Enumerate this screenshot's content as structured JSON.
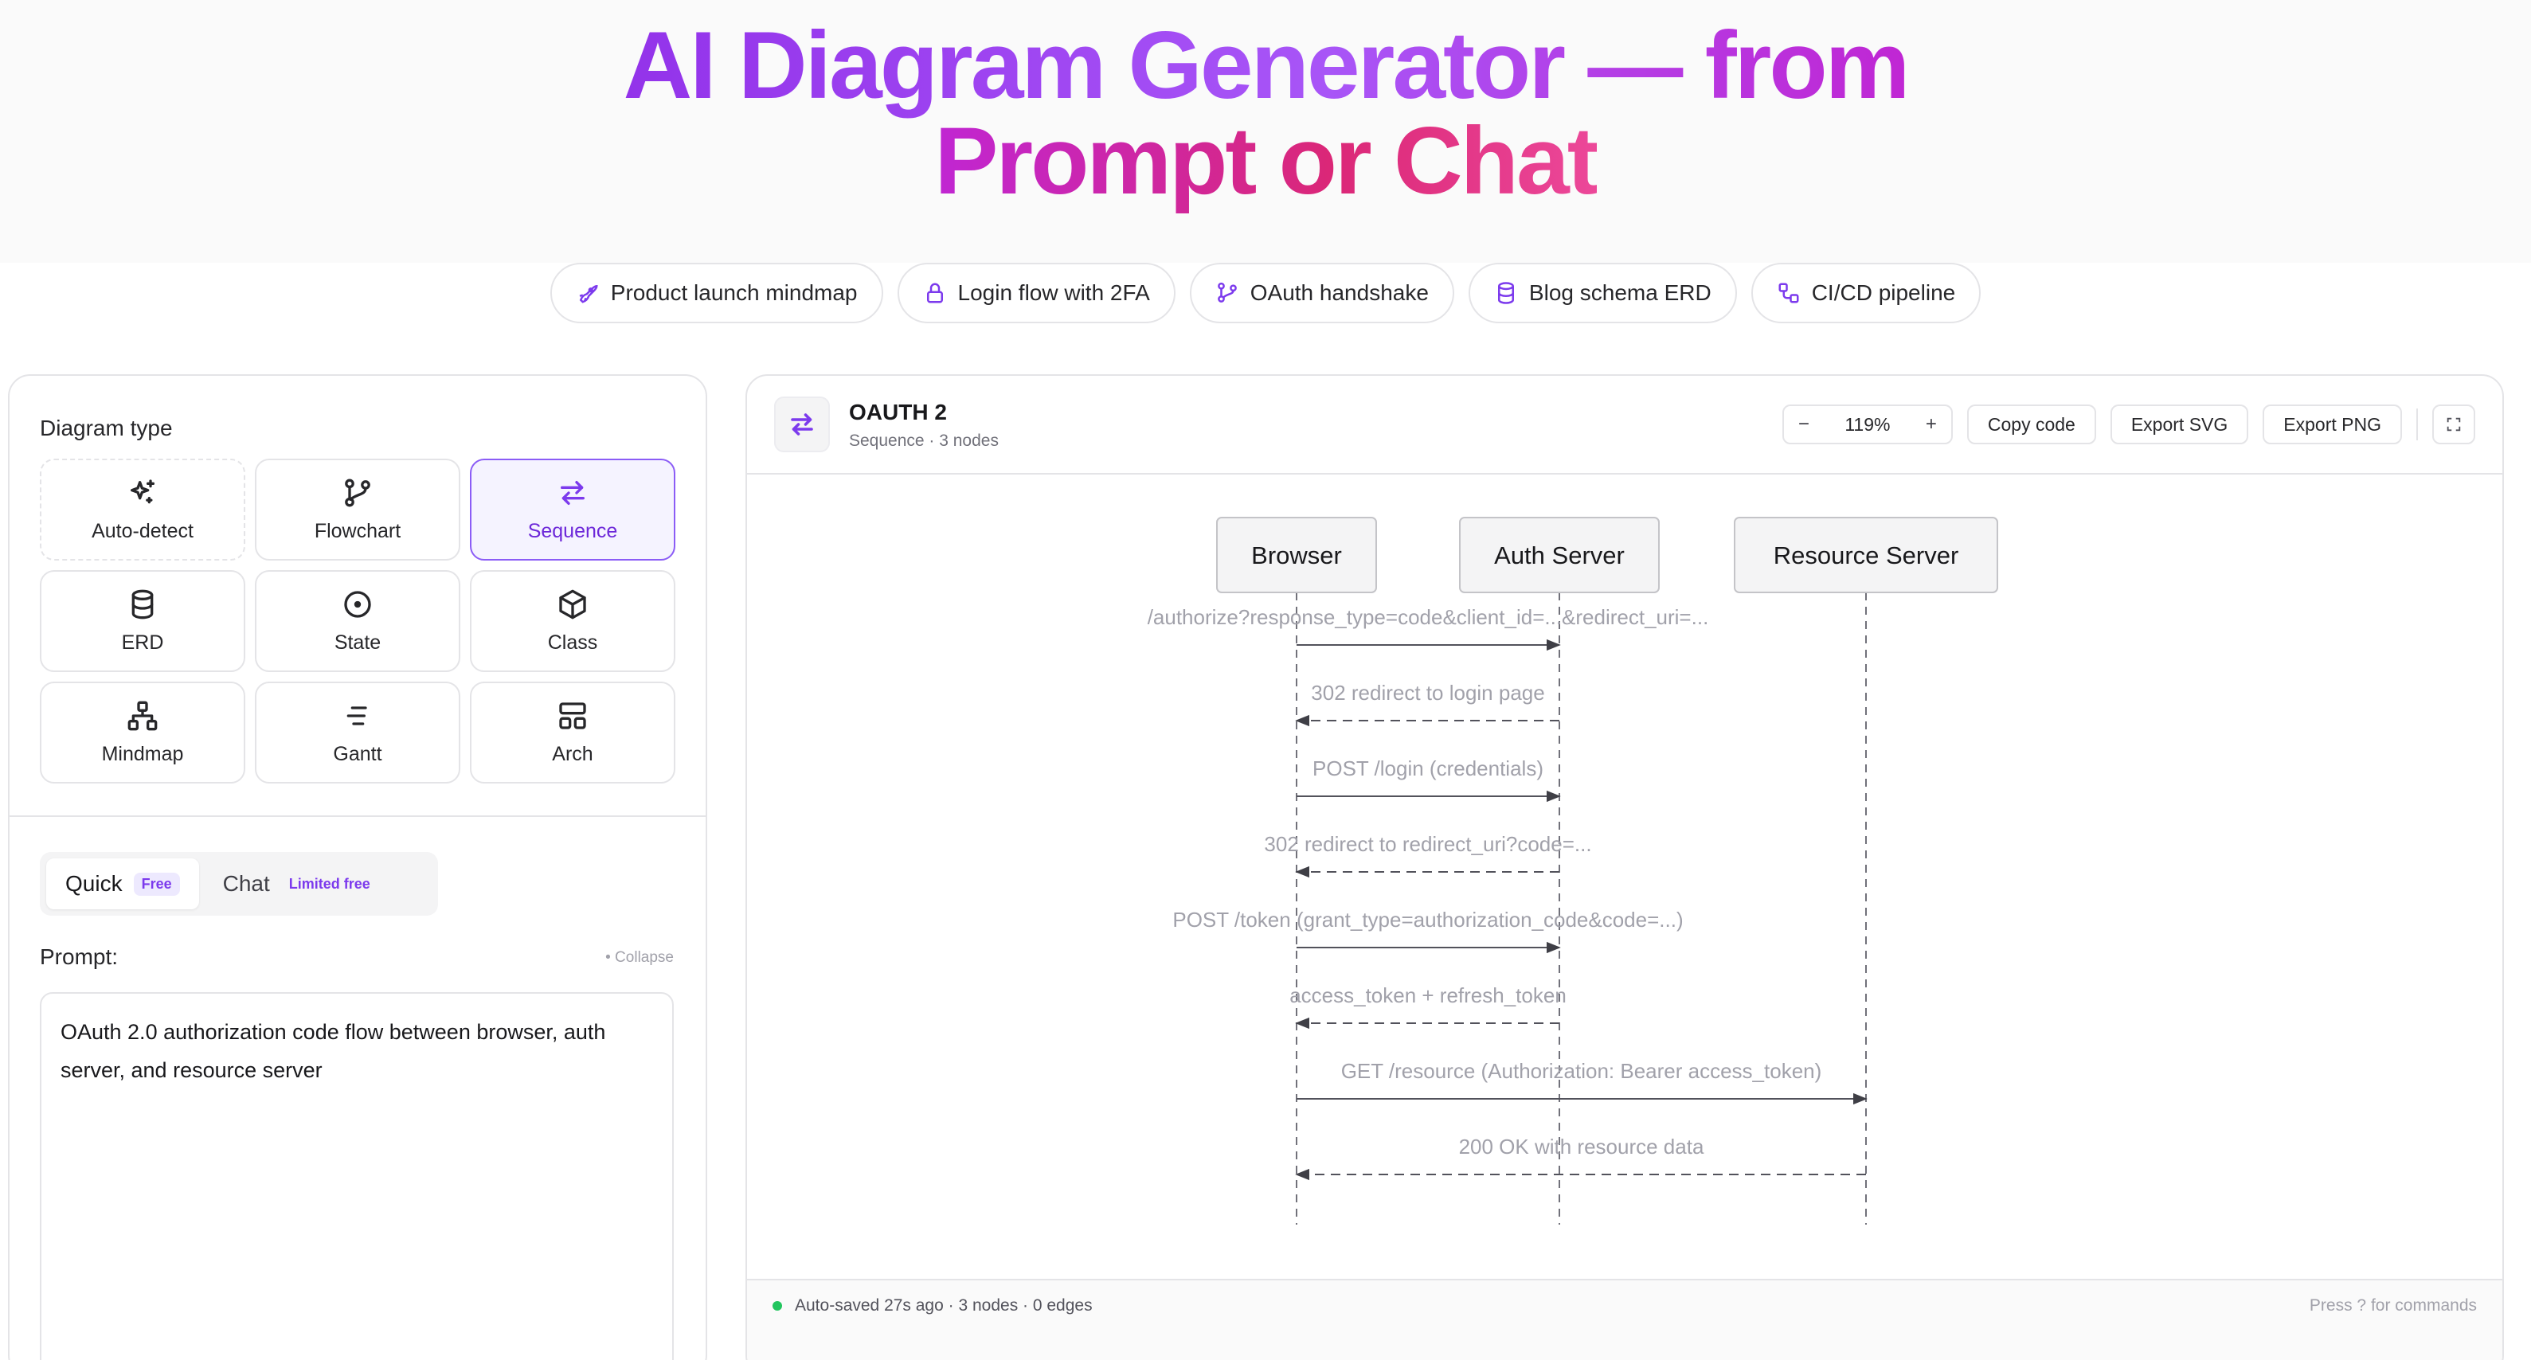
{
  "hero": {
    "line1": "AI Diagram Generator — from",
    "line2": "Prompt or Chat"
  },
  "examples": [
    {
      "label": "Product launch mindmap",
      "icon": "rocket-icon"
    },
    {
      "label": "Login flow with 2FA",
      "icon": "lock-icon"
    },
    {
      "label": "OAuth handshake",
      "icon": "branch-icon"
    },
    {
      "label": "Blog schema ERD",
      "icon": "database-icon"
    },
    {
      "label": "CI/CD pipeline",
      "icon": "workflow-icon"
    }
  ],
  "sidebar": {
    "diagram_type_label": "Diagram type",
    "types": [
      {
        "label": "Auto-detect",
        "icon": "sparkles-icon"
      },
      {
        "label": "Flowchart",
        "icon": "git-branch-icon"
      },
      {
        "label": "Sequence",
        "icon": "arrows-left-right-icon",
        "selected": true
      },
      {
        "label": "ERD",
        "icon": "database-icon"
      },
      {
        "label": "State",
        "icon": "circle-dot-icon"
      },
      {
        "label": "Class",
        "icon": "box-icon"
      },
      {
        "label": "Mindmap",
        "icon": "network-icon"
      },
      {
        "label": "Gantt",
        "icon": "gantt-icon"
      },
      {
        "label": "Arch",
        "icon": "layout-icon"
      }
    ],
    "modes": [
      {
        "label": "Quick",
        "badge": "Free",
        "active": true
      },
      {
        "label": "Chat",
        "badge": "Limited free",
        "active": false
      }
    ],
    "prompt_label": "Prompt:",
    "collapse_label": "• Collapse",
    "prompt_value": "OAuth 2.0 authorization code flow between browser, auth server, and resource server"
  },
  "canvas": {
    "title": "OAUTH 2",
    "subtitle": "Sequence · 3 nodes",
    "zoom_minus": "−",
    "zoom_level": "119%",
    "zoom_plus": "+",
    "copy_code": "Copy code",
    "export_svg": "Export SVG",
    "export_png": "Export PNG",
    "accent": "#7c3aed"
  },
  "sequence": {
    "participants": [
      "Browser",
      "Auth Server",
      "Resource Server"
    ],
    "messages": [
      {
        "from": 0,
        "to": 1,
        "text": "/authorize?response_type=code&client_id=...&redirect_uri=...",
        "dashed": false
      },
      {
        "from": 1,
        "to": 0,
        "text": "302 redirect to login page",
        "dashed": true
      },
      {
        "from": 0,
        "to": 1,
        "text": "POST /login (credentials)",
        "dashed": false
      },
      {
        "from": 1,
        "to": 0,
        "text": "302 redirect to redirect_uri?code=...",
        "dashed": true
      },
      {
        "from": 0,
        "to": 1,
        "text": "POST /token (grant_type=authorization_code&code=...)",
        "dashed": false
      },
      {
        "from": 1,
        "to": 0,
        "text": "access_token + refresh_token",
        "dashed": true
      },
      {
        "from": 0,
        "to": 2,
        "text": "GET /resource (Authorization: Bearer access_token)",
        "dashed": false
      },
      {
        "from": 2,
        "to": 0,
        "text": "200 OK with resource data",
        "dashed": true
      }
    ]
  },
  "status": {
    "left": "Auto-saved 27s ago · 3 nodes · 0 edges",
    "right": "Press ? for commands"
  }
}
